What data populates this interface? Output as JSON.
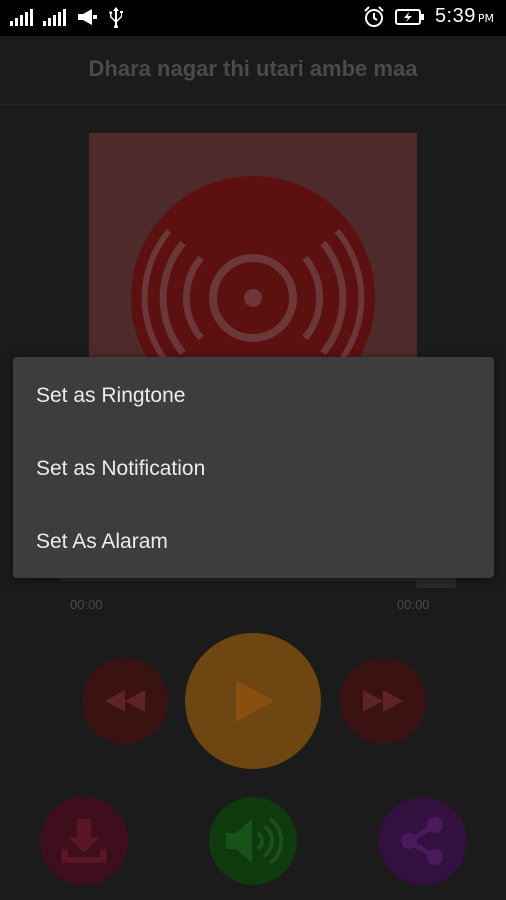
{
  "status_bar": {
    "time": "5:39",
    "ampm": "PM",
    "icons": [
      "signal-icon",
      "signal-icon",
      "megaphone-icon",
      "usb-icon",
      "alarm-icon",
      "battery-charging-icon"
    ]
  },
  "player": {
    "song_title": "Dhara nagar thi utari ambe maa",
    "current_time": "00:00",
    "total_time": "00:00"
  },
  "menu": {
    "items": [
      {
        "label": "Set as Ringtone"
      },
      {
        "label": "Set as Notification"
      },
      {
        "label": "Set As Alaram"
      }
    ]
  },
  "colors": {
    "play": "#6e4611",
    "rewind_forward": "#3b1212",
    "download": "#3f0e1d",
    "volume": "#0e3a0e",
    "share": "#33103f",
    "menu_bg": "#3d3d3d"
  }
}
